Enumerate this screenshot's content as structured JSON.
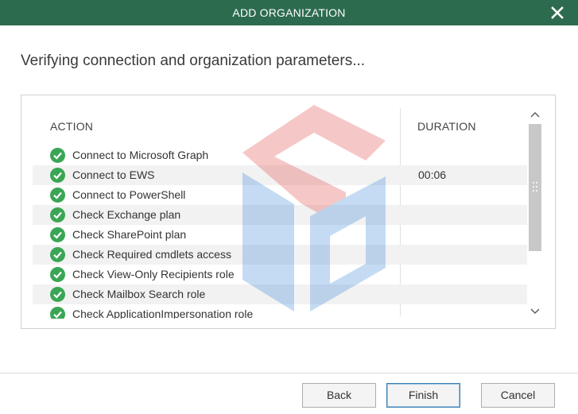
{
  "dialog": {
    "title": "ADD ORGANIZATION",
    "close_icon": "close-icon",
    "heading": "Verifying connection and organization parameters..."
  },
  "table": {
    "columns": {
      "action": "ACTION",
      "duration": "DURATION"
    },
    "rows": [
      {
        "label": "Connect to Microsoft Graph",
        "duration": "",
        "status": "success"
      },
      {
        "label": "Connect to EWS",
        "duration": "00:06",
        "status": "success"
      },
      {
        "label": "Connect to PowerShell",
        "duration": "",
        "status": "success"
      },
      {
        "label": "Check Exchange plan",
        "duration": "",
        "status": "success"
      },
      {
        "label": "Check SharePoint plan",
        "duration": "",
        "status": "success"
      },
      {
        "label": "Check Required cmdlets access",
        "duration": "",
        "status": "success"
      },
      {
        "label": "Check View-Only Recipients role",
        "duration": "",
        "status": "success"
      },
      {
        "label": "Check Mailbox Search role",
        "duration": "",
        "status": "success"
      },
      {
        "label": "Check ApplicationImpersonation role",
        "duration": "",
        "status": "success"
      }
    ]
  },
  "buttons": {
    "back": "Back",
    "finish": "Finish",
    "cancel": "Cancel"
  },
  "colors": {
    "titlebar": "#2d6b4f",
    "success": "#3aa655",
    "watermark_red": "#e23b3b",
    "watermark_blue": "#2f7fd6"
  },
  "icons": {
    "status": "check-circle-icon",
    "scroll_up": "chevron-up-icon",
    "scroll_down": "chevron-down-icon"
  }
}
